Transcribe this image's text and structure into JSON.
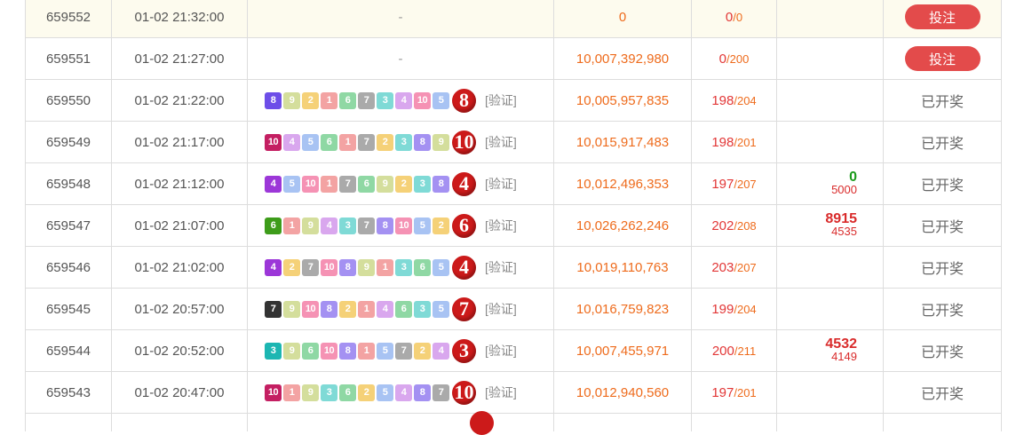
{
  "columns_note": "",
  "rows": [
    {
      "id": "659552",
      "time": "01-02 21:32:00",
      "result": null,
      "dash": "-",
      "amount": "0",
      "win_num": "0",
      "win_den": "/0",
      "my_top": "",
      "my_bot": "",
      "action": "投注",
      "action_type": "button"
    },
    {
      "id": "659551",
      "time": "01-02 21:27:00",
      "result": null,
      "dash": "-",
      "amount": "10,007,392,980",
      "win_num": "0",
      "win_den": "/200",
      "my_top": "",
      "my_bot": "",
      "action": "投注",
      "action_type": "button"
    },
    {
      "id": "659550",
      "time": "01-02 21:22:00",
      "balls": [
        [
          "8",
          "s6"
        ],
        [
          "9",
          "b9"
        ],
        [
          "2",
          "b2"
        ],
        [
          "1",
          "b1"
        ],
        [
          "6",
          "b6"
        ],
        [
          "7",
          "b7"
        ],
        [
          "3",
          "b3"
        ],
        [
          "4",
          "b4"
        ],
        [
          "10",
          "b10"
        ],
        [
          "5",
          "b5"
        ]
      ],
      "big": "8",
      "verify": "[验证]",
      "amount": "10,005,957,835",
      "win_num": "198",
      "win_den": "/204",
      "my_top": "",
      "my_bot": "",
      "action": "已开奖",
      "action_type": "text"
    },
    {
      "id": "659549",
      "time": "01-02 21:17:00",
      "balls": [
        [
          "10",
          "s5"
        ],
        [
          "4",
          "b4"
        ],
        [
          "5",
          "b5"
        ],
        [
          "6",
          "b6"
        ],
        [
          "1",
          "b1"
        ],
        [
          "7",
          "b7"
        ],
        [
          "2",
          "b2"
        ],
        [
          "3",
          "b3"
        ],
        [
          "8",
          "b8"
        ],
        [
          "9",
          "b9"
        ]
      ],
      "big": "10",
      "verify": "[验证]",
      "amount": "10,015,917,483",
      "win_num": "198",
      "win_den": "/201",
      "my_top": "",
      "my_bot": "",
      "action": "已开奖",
      "action_type": "text"
    },
    {
      "id": "659548",
      "time": "01-02 21:12:00",
      "balls": [
        [
          "4",
          "s2"
        ],
        [
          "5",
          "b5"
        ],
        [
          "10",
          "b10"
        ],
        [
          "1",
          "b1"
        ],
        [
          "7",
          "b7"
        ],
        [
          "6",
          "b6"
        ],
        [
          "9",
          "b9"
        ],
        [
          "2",
          "b2"
        ],
        [
          "3",
          "b3"
        ],
        [
          "8",
          "b8"
        ]
      ],
      "big": "4",
      "verify": "[验证]",
      "amount": "10,012,496,353",
      "win_num": "197",
      "win_den": "/207",
      "my_top": "0",
      "my_top_green": true,
      "my_bot": "5000",
      "action": "已开奖",
      "action_type": "text"
    },
    {
      "id": "659547",
      "time": "01-02 21:07:00",
      "balls": [
        [
          "6",
          "s3"
        ],
        [
          "1",
          "b1"
        ],
        [
          "9",
          "b9"
        ],
        [
          "4",
          "b4"
        ],
        [
          "3",
          "b3"
        ],
        [
          "7",
          "b7"
        ],
        [
          "8",
          "b8"
        ],
        [
          "10",
          "b10"
        ],
        [
          "5",
          "b5"
        ],
        [
          "2",
          "b2"
        ]
      ],
      "big": "6",
      "verify": "[验证]",
      "amount": "10,026,262,246",
      "win_num": "202",
      "win_den": "/208",
      "my_top": "8915",
      "my_bot": "4535",
      "action": "已开奖",
      "action_type": "text"
    },
    {
      "id": "659546",
      "time": "01-02 21:02:00",
      "balls": [
        [
          "4",
          "s2"
        ],
        [
          "2",
          "b2"
        ],
        [
          "7",
          "b7"
        ],
        [
          "10",
          "b10"
        ],
        [
          "8",
          "b8"
        ],
        [
          "9",
          "b9"
        ],
        [
          "1",
          "b1"
        ],
        [
          "3",
          "b3"
        ],
        [
          "6",
          "b6"
        ],
        [
          "5",
          "b5"
        ]
      ],
      "big": "4",
      "verify": "[验证]",
      "amount": "10,019,110,763",
      "win_num": "203",
      "win_den": "/207",
      "my_top": "",
      "my_bot": "",
      "action": "已开奖",
      "action_type": "text"
    },
    {
      "id": "659545",
      "time": "01-02 20:57:00",
      "balls": [
        [
          "7",
          "s4"
        ],
        [
          "9",
          "b9"
        ],
        [
          "10",
          "b10"
        ],
        [
          "8",
          "b8"
        ],
        [
          "2",
          "b2"
        ],
        [
          "1",
          "b1"
        ],
        [
          "4",
          "b4"
        ],
        [
          "6",
          "b6"
        ],
        [
          "3",
          "b3"
        ],
        [
          "5",
          "b5"
        ]
      ],
      "big": "7",
      "verify": "[验证]",
      "amount": "10,016,759,823",
      "win_num": "199",
      "win_den": "/204",
      "my_top": "",
      "my_bot": "",
      "action": "已开奖",
      "action_type": "text"
    },
    {
      "id": "659544",
      "time": "01-02 20:52:00",
      "balls": [
        [
          "3",
          "s1"
        ],
        [
          "9",
          "b9"
        ],
        [
          "6",
          "b6"
        ],
        [
          "10",
          "b10"
        ],
        [
          "8",
          "b8"
        ],
        [
          "1",
          "b1"
        ],
        [
          "5",
          "b5"
        ],
        [
          "7",
          "b7"
        ],
        [
          "2",
          "b2"
        ],
        [
          "4",
          "b4"
        ]
      ],
      "big": "3",
      "verify": "[验证]",
      "amount": "10,007,455,971",
      "win_num": "200",
      "win_den": "/211",
      "my_top": "4532",
      "my_bot": "4149",
      "action": "已开奖",
      "action_type": "text"
    },
    {
      "id": "659543",
      "time": "01-02 20:47:00",
      "balls": [
        [
          "10",
          "s5"
        ],
        [
          "1",
          "b1"
        ],
        [
          "9",
          "b9"
        ],
        [
          "3",
          "b3"
        ],
        [
          "6",
          "b6"
        ],
        [
          "2",
          "b2"
        ],
        [
          "5",
          "b5"
        ],
        [
          "4",
          "b4"
        ],
        [
          "8",
          "b8"
        ],
        [
          "7",
          "b7"
        ]
      ],
      "big": "10",
      "verify": "[验证]",
      "amount": "10,012,940,560",
      "win_num": "197",
      "win_den": "/201",
      "my_top": "",
      "my_bot": "",
      "action": "已开奖",
      "action_type": "text"
    }
  ]
}
